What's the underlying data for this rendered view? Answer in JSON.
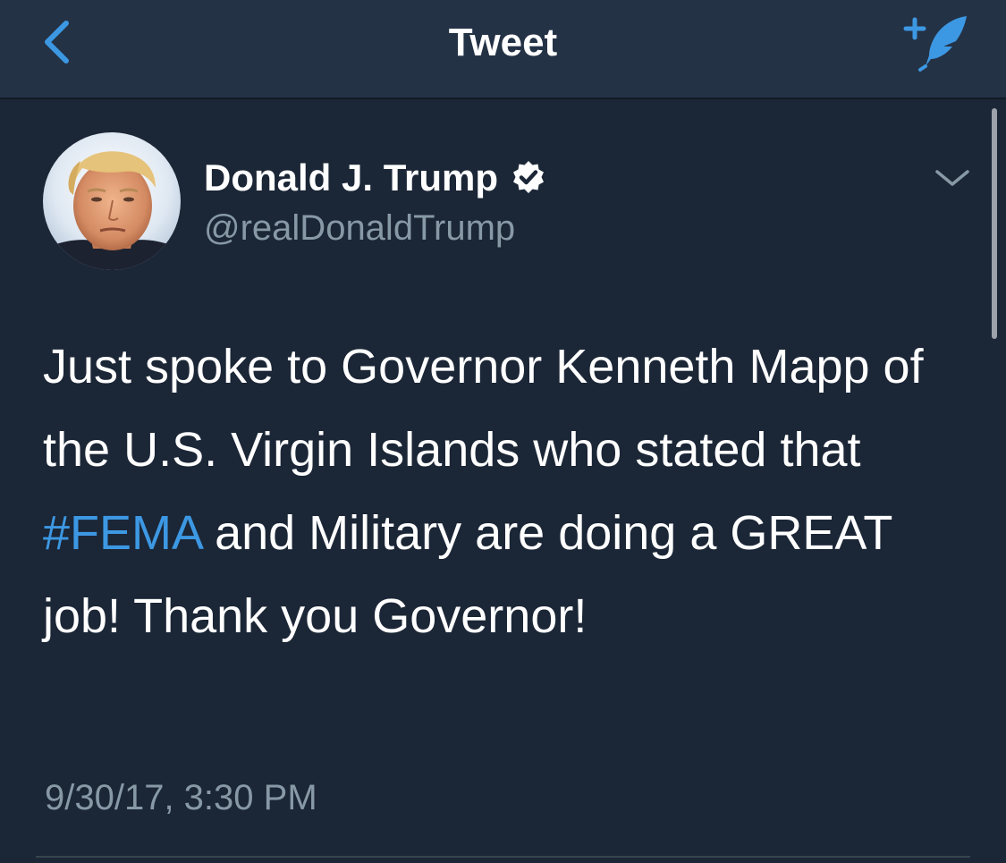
{
  "nav": {
    "title": "Tweet",
    "back_icon": "chevron-left-icon",
    "compose_icon": "compose-quill-icon"
  },
  "tweet": {
    "author": {
      "display_name": "Donald J. Trump",
      "handle": "@realDonaldTrump",
      "verified": true,
      "avatar": "profile-photo"
    },
    "text_before_hashtag": "Just spoke to Governor Kenneth Mapp of the U.S. Virgin Islands who stated that ",
    "hashtag": "#FEMA",
    "text_after_hashtag": " and Military are doing a GREAT job! Thank you Governor!",
    "timestamp": "9/30/17, 3:30 PM",
    "menu_icon": "chevron-down-icon"
  },
  "colors": {
    "background": "#1b2636",
    "navbar": "#243246",
    "text_primary": "#ffffff",
    "text_secondary": "#8899a6",
    "accent": "#3d98e3"
  }
}
